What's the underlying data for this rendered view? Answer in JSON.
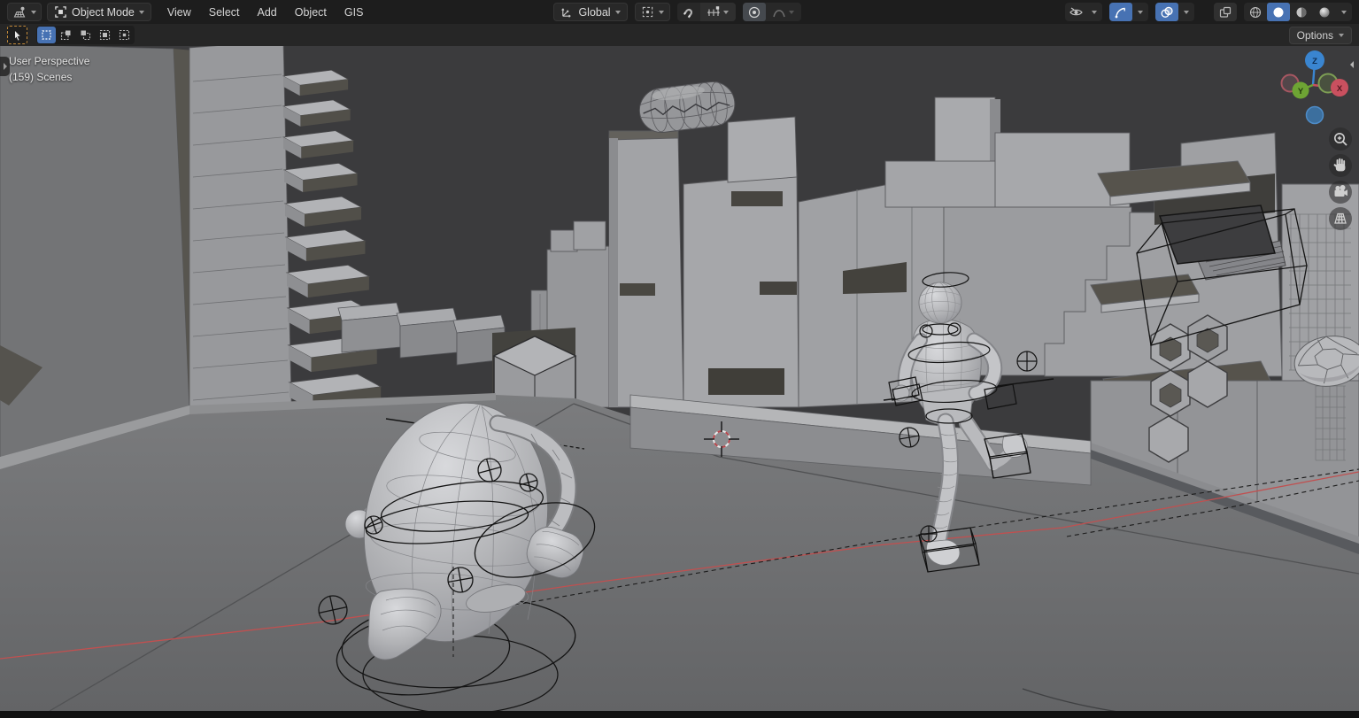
{
  "header": {
    "editor_type_button": {
      "icon": "editor-3d-viewport-icon"
    },
    "mode_select": {
      "value": "Object Mode",
      "icon": "object-mode-icon"
    },
    "menus": [
      {
        "label": "View"
      },
      {
        "label": "Select"
      },
      {
        "label": "Add"
      },
      {
        "label": "Object"
      },
      {
        "label": "GIS"
      }
    ],
    "orientation_select": {
      "value": "Global",
      "icon": "orientation-axes-icon"
    },
    "pivot_button": {
      "icon": "pivot-point-icon"
    },
    "snap_toggle": {
      "icon": "magnet-icon",
      "active": false
    },
    "snap_with_button": {
      "icon": "snap-increment-icon"
    },
    "proportional_toggle": {
      "icon": "proportional-editing-icon",
      "active": true
    },
    "falloff_button": {
      "icon": "falloff-curve-icon",
      "disabled": true
    },
    "visibility_button": {
      "icon": "show-object-types-icon"
    },
    "gizmos_toggle": {
      "icon": "gizmos-icon",
      "active": true
    },
    "overlays_toggle": {
      "icon": "overlays-icon",
      "active": true
    },
    "xray_toggle": {
      "icon": "xray-icon",
      "active": false
    },
    "shading": {
      "modes": [
        "wireframe",
        "solid",
        "material",
        "rendered"
      ],
      "active": "solid"
    }
  },
  "tool_bar": {
    "active_tool": "select-box",
    "select_modes": [
      "set",
      "extend",
      "subtract",
      "invert",
      "intersect"
    ],
    "active_select_mode": "set",
    "options_button": {
      "label": "Options"
    }
  },
  "viewport": {
    "overlay_text": {
      "line1": "User Perspective",
      "line2": "(159) Scenes"
    },
    "gizmo": {
      "x_label": "X",
      "y_label": "Y",
      "z_label": "Z"
    },
    "nav_buttons": [
      "zoom",
      "pan",
      "camera-view",
      "toggle-orthographic"
    ],
    "scene_objects": [
      "city blocks",
      "balcony building",
      "blimp",
      "round character",
      "running character",
      "selected dark plane",
      "hex pillars",
      "egg ball",
      "3d cursor"
    ]
  },
  "colors": {
    "accent_blue": "#4772b3",
    "header_bg": "#1d1d1d",
    "sky": "#3b3b3d",
    "selection_outline": "#141414",
    "motion_path_red": "#c05050",
    "axis_x_red": "#c9505f",
    "axis_y_green": "#6ea434",
    "axis_z_blue": "#3a85d0",
    "active_tool_amber": "#c28a3a"
  },
  "status_bar": {
    "visible": true
  }
}
